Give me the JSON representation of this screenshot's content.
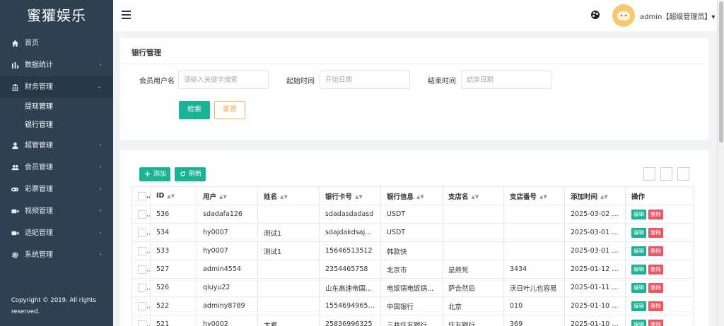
{
  "sidebar": {
    "brand": "蜜獾娱乐",
    "items": [
      {
        "label": "首页",
        "icon": "home-icon",
        "arrow": ""
      },
      {
        "label": "数据统计",
        "icon": "bar-chart-icon",
        "arrow": "›"
      },
      {
        "label": "财务管理",
        "icon": "bank-icon",
        "arrow": "⌄"
      },
      {
        "label": "超管管理",
        "icon": "user-icon",
        "arrow": "›"
      },
      {
        "label": "会员管理",
        "icon": "users-icon",
        "arrow": "›"
      },
      {
        "label": "彩票管理",
        "icon": "gamepad-icon",
        "arrow": "›"
      },
      {
        "label": "视频管理",
        "icon": "video-icon",
        "arrow": "›"
      },
      {
        "label": "选妃管理",
        "icon": "video-icon",
        "arrow": "›"
      },
      {
        "label": "系统管理",
        "icon": "gear-icon",
        "arrow": "›"
      }
    ],
    "submenu": [
      "提现管理",
      "银行管理"
    ],
    "copyright": "Copyright © 2019. All rights reserved."
  },
  "header": {
    "user": "admin【超级管理员】▾"
  },
  "search": {
    "title": "银行管理",
    "member_label": "会员用户名",
    "member_placeholder": "请输入关键字搜索",
    "start_label": "起始时间",
    "start_placeholder": "开始日期",
    "end_label": "结束时间",
    "end_placeholder": "结束日期",
    "search_btn": "检索",
    "reset_btn": "重置"
  },
  "table": {
    "add_btn": "添加",
    "refresh_btn": "刷新",
    "columns": [
      "ID",
      "用户",
      "姓名",
      "银行卡号",
      "银行信息",
      "支店名",
      "支店番号",
      "添加时间",
      "操作"
    ],
    "edit_label": "编辑",
    "delete_label": "删除",
    "rows": [
      {
        "id": "536",
        "user": "sdadafa126",
        "name": "",
        "card": "sdadasdadasd",
        "bank": "USDT",
        "branch": "",
        "branch_no": "",
        "time": "2025-03-02 1..."
      },
      {
        "id": "534",
        "user": "hy0007",
        "name": "测试1",
        "card": "sdajdakdsajd...",
        "bank": "USDT",
        "branch": "",
        "branch_no": "",
        "time": "2025-03-01 1..."
      },
      {
        "id": "533",
        "user": "hy0007",
        "name": "测试1",
        "card": "15646513512",
        "bank": "韩款快",
        "branch": "",
        "branch_no": "",
        "time": "2025-03-01 1..."
      },
      {
        "id": "527",
        "user": "admin4554",
        "name": "",
        "card": "2354465758",
        "bank": "北京市",
        "branch": "是熬死",
        "branch_no": "3434",
        "time": "2025-01-12 1..."
      },
      {
        "id": "526",
        "user": "qiuyu22",
        "name": "",
        "card": "山东高速帝国...",
        "bank": "电饭锅电饭锅...",
        "branch": "萨合然后",
        "branch_no": "沃日叶儿也容易",
        "time": "2025-01-11 1..."
      },
      {
        "id": "522",
        "user": "adminy8789",
        "name": "",
        "card": "155469496544",
        "bank": "中国银行",
        "branch": "北京",
        "branch_no": "010",
        "time": "2025-01-10 1..."
      },
      {
        "id": "521",
        "user": "hy0002",
        "name": "太君",
        "card": "25836996325",
        "bank": "三井住友银行",
        "branch": "住友银行",
        "branch_no": "369",
        "time": "2025-01-10 1..."
      }
    ]
  }
}
